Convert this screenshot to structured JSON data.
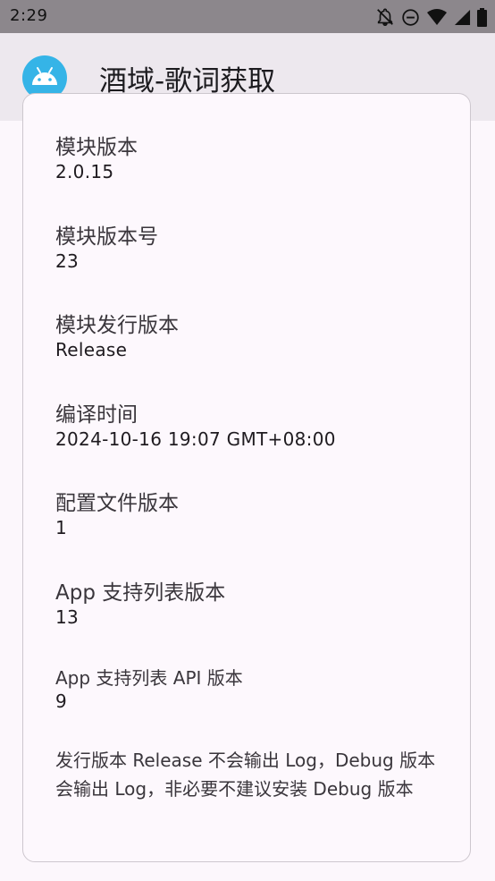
{
  "status_bar": {
    "time": "2:29",
    "icons": [
      "notifications-off-icon",
      "do-not-disturb-icon",
      "wifi-icon",
      "signal-icon",
      "battery-icon"
    ]
  },
  "app_bar": {
    "icon": "android-icon",
    "title": "酒域-歌词获取",
    "accent_color": "#35b4e7"
  },
  "info": {
    "items": [
      {
        "label": "模块版本",
        "value": "2.0.15"
      },
      {
        "label": "模块版本号",
        "value": "23"
      },
      {
        "label": "模块发行版本",
        "value": "Release"
      },
      {
        "label": "编译时间",
        "value": "2024-10-16 19:07 GMT+08:00"
      },
      {
        "label": "配置文件版本",
        "value": "1"
      },
      {
        "label": "App 支持列表版本",
        "value": "13"
      },
      {
        "label": "App 支持列表 API 版本",
        "value": "9"
      }
    ],
    "note": "发行版本 Release 不会输出 Log，Debug 版本会输出 Log，非必要不建议安装 Debug 版本"
  }
}
